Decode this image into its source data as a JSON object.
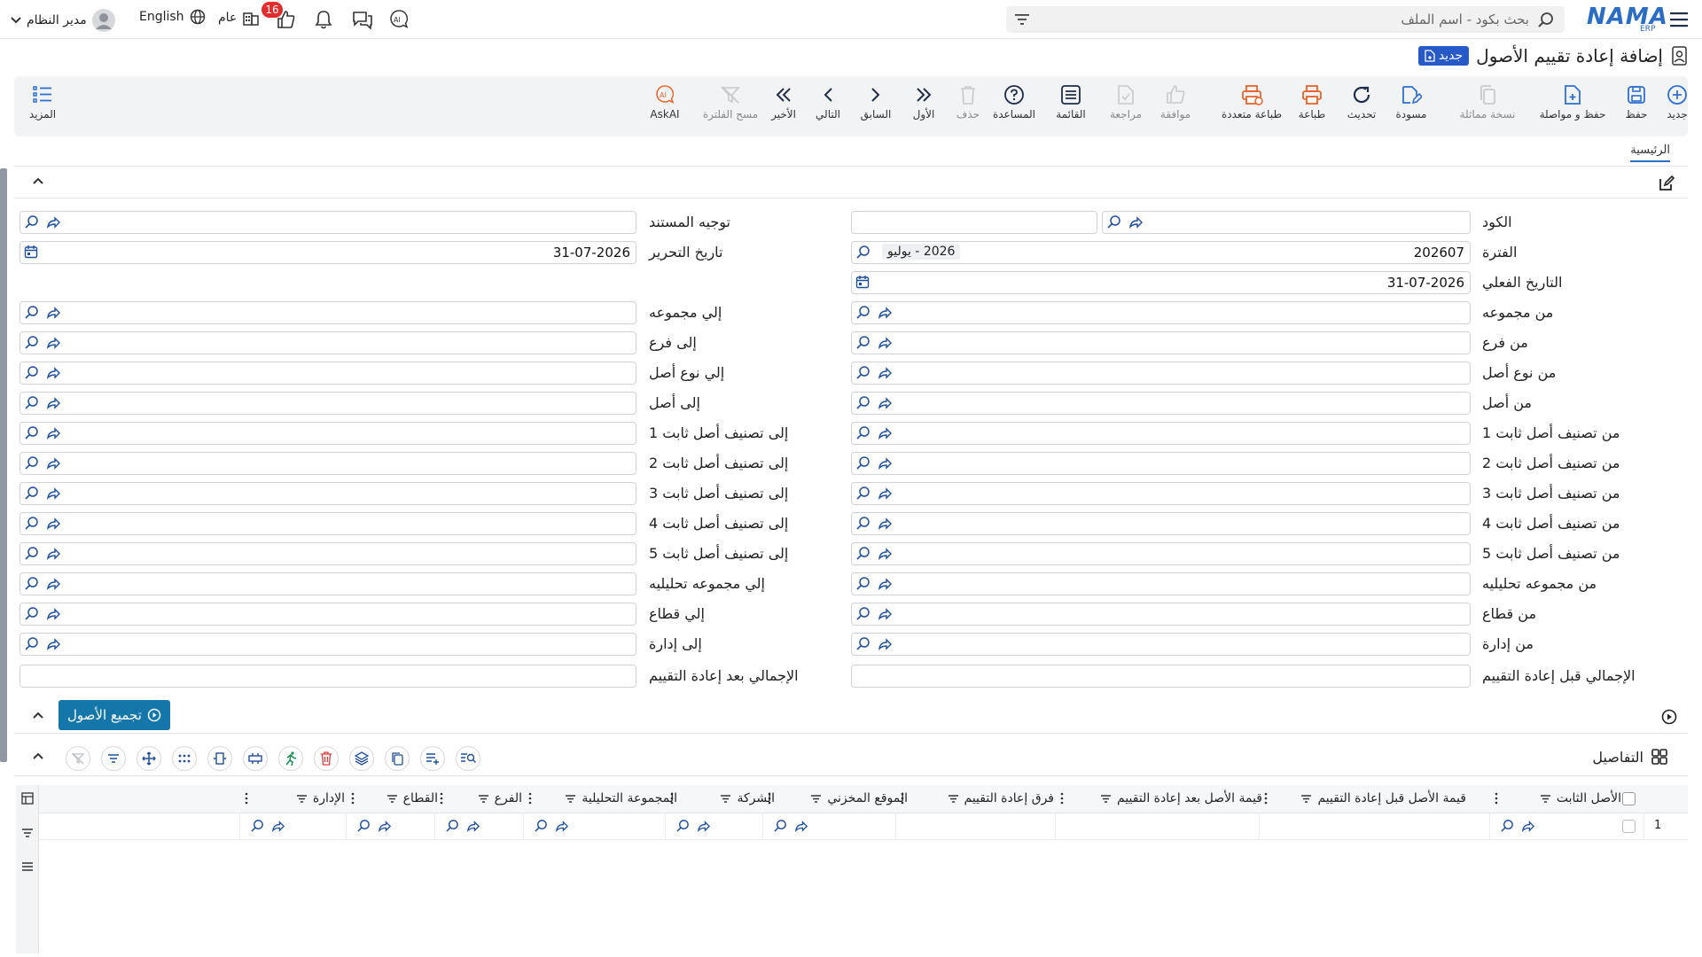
{
  "topbar": {
    "brand": "NAMA",
    "brand_sub": "ERP",
    "search_placeholder": "بحث بكود - اسم الملف",
    "user_name": "مدير النظام",
    "language": "English",
    "scope": "عام",
    "notification_count": "16"
  },
  "page": {
    "title": "إضافة إعادة تقييم الأصول",
    "status_badge": "جديد"
  },
  "toolbar": {
    "new": "جديد",
    "save": "حفظ",
    "save_continue": "حفظ و مواصلة",
    "copy_similar": "نسخة مماثلة",
    "draft": "مسودة",
    "refresh": "تحديث",
    "print": "طباعة",
    "multi_print": "طباعة متعددة",
    "approve": "موافقة",
    "review": "مراجعة",
    "list": "القائمة",
    "help": "المساعدة",
    "delete": "حذف",
    "first": "الأول",
    "previous": "السابق",
    "next": "التالي",
    "last": "الأخير",
    "clear_filter": "مسح الفلترة",
    "askai": "AskAI",
    "more": "المزيد"
  },
  "tabs": {
    "main": "الرئيسية"
  },
  "form": {
    "code_label": "الكود",
    "doc_direction_label": "توجيه المستند",
    "period_label": "الفترة",
    "period_value": "202607",
    "period_name": "2026 - يوليو",
    "edit_date_label": "تاريخ التحرير",
    "edit_date_value": "31-07-2026",
    "actual_date_label": "التاريخ الفعلي",
    "actual_date_value": "31-07-2026",
    "from_group": "من مجموعه",
    "to_group": "إلي مجموعه",
    "from_branch": "من فرع",
    "to_branch": "إلى فرع",
    "from_asset_type": "من نوع أصل",
    "to_asset_type": "إلي نوع أصل",
    "from_asset": "من أصل",
    "to_asset": "إلى أصل",
    "from_class1": "من تصنيف أصل ثابت 1",
    "to_class1": "إلى تصنيف أصل ثابت 1",
    "from_class2": "من تصنيف أصل ثابت 2",
    "to_class2": "إلى تصنيف أصل ثابت 2",
    "from_class3": "من تصنيف أصل ثابت 3",
    "to_class3": "إلى تصنيف أصل ثابت 3",
    "from_class4": "من تصنيف أصل ثابت 4",
    "to_class4": "إلى تصنيف أصل ثابت 4",
    "from_class5": "من تصنيف أصل ثابت 5",
    "to_class5": "إلى تصنيف أصل ثابت 5",
    "from_analytic": "من مجموعه تحليليه",
    "to_analytic": "إلي مجموعه تحليليه",
    "from_sector": "من قطاع",
    "to_sector": "إلي قطاع",
    "from_dept": "من إدارة",
    "to_dept": "إلى إدارة",
    "total_before": "الإجمالي قبل إعادة التقييم",
    "total_after": "الإجمالي بعد إعادة التقييم"
  },
  "collect_button": "تجميع الأصول",
  "details": {
    "title": "التفاصيل",
    "columns": [
      "الأصل الثابت",
      "قيمة الأصل قبل إعادة التقييم",
      "قيمة الأصل بعد إعادة التقييم",
      "فرق إعادة التقييم",
      "الموقع المخزني",
      "الشركة",
      "المجموعة التحليلية",
      "الفرع",
      "القطاع",
      "الإدارة"
    ],
    "rows": [
      {
        "index": "1"
      }
    ]
  }
}
